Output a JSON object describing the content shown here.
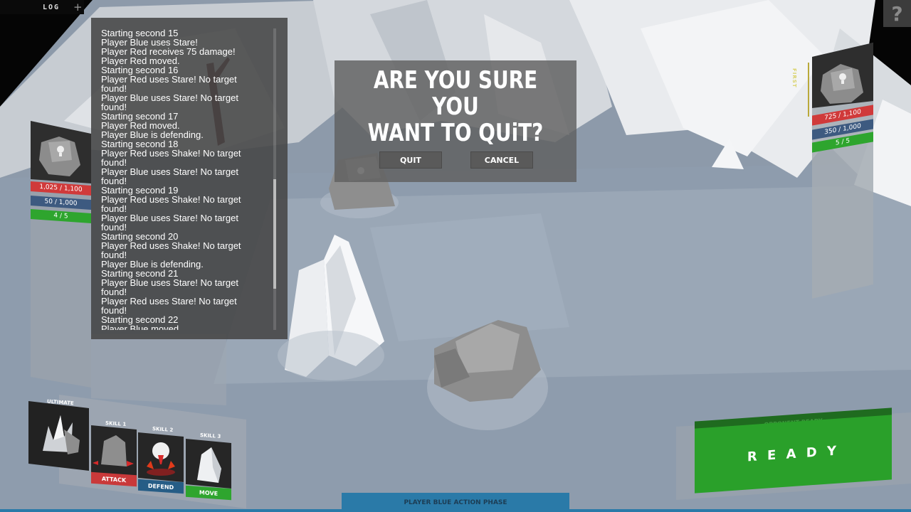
{
  "header": {
    "log_tab": "LOG",
    "log_plus": "+",
    "help": "?"
  },
  "log": {
    "lines": [
      "Starting second 15",
      "Player Blue uses Stare!",
      "Player Red receives 75 damage!",
      "Player Red moved.",
      "Starting second 16",
      "Player Red uses Stare! No target",
      "found!",
      "Player Blue uses Stare! No target",
      "found!",
      "Starting second 17",
      "Player Red moved.",
      "Player Blue is defending.",
      "Starting second 18",
      "Player Red uses Shake! No target",
      "found!",
      "Player Blue uses Stare! No target",
      "found!",
      "Starting second 19",
      "Player Red uses Shake! No target",
      "found!",
      "Player Blue uses Stare! No target",
      "found!",
      "Starting second 20",
      "Player Red uses Shake! No target",
      "found!",
      "Player Blue is defending.",
      "Starting second 21",
      "Player Blue uses Stare! No target",
      "found!",
      "Player Red uses Stare! No target",
      "found!",
      "Starting second 22",
      "Player Blue moved."
    ]
  },
  "dialog": {
    "title_line1": "ARE YOU SURE YOU",
    "title_line2": "WANT TO QUiT?",
    "quit": "QUIT",
    "cancel": "CANCEL"
  },
  "player_card": {
    "hp": "1,025 / 1,100",
    "energy": "50 / 1,000",
    "actions": "4 / 5"
  },
  "opponent_card": {
    "label": "FIRST",
    "hp": "725 / 1,100",
    "energy": "350 / 1,000",
    "actions": "5 / 5"
  },
  "skills": {
    "ultimate": "ULTIMATE",
    "skill1": "SKILL 1",
    "skill1_action": "ATTACK",
    "skill2": "SKILL 2",
    "skill2_action": "DEFEND",
    "skill3": "SKILL 3",
    "skill3_action": "MOVE"
  },
  "ready": {
    "opponent_status": "OPPONENT READY",
    "label": "R E A D Y"
  },
  "phase": "PLAYER BLUE ACTION PHASE",
  "colors": {
    "hp": "#d03a3a",
    "energy": "#3d5a80",
    "actions": "#2ea52e",
    "phase": "#2a7aa8",
    "ready": "#2aa02a"
  }
}
